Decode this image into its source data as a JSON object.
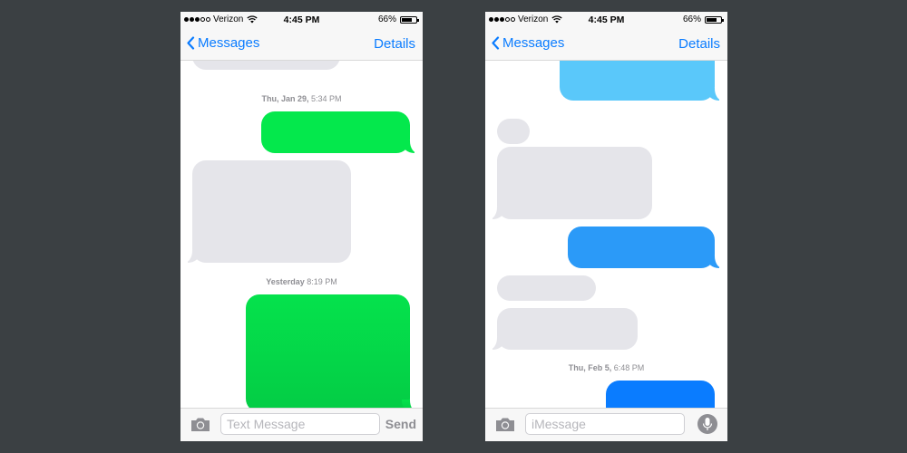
{
  "colors": {
    "background": "#3b4043",
    "ios_blue": "#0a7cff",
    "sms_green": "#04e84c",
    "received_gray": "#e5e5ea"
  },
  "left_phone": {
    "status": {
      "carrier": "Verizon",
      "time": "4:45 PM",
      "battery": "66%",
      "battery_level": 0.66
    },
    "nav": {
      "back_label": "Messages",
      "details_label": "Details"
    },
    "timestamps": [
      {
        "day": "Thu, Jan 29,",
        "time": "5:34 PM"
      },
      {
        "day": "Yesterday",
        "time": "8:19 PM"
      }
    ],
    "input": {
      "placeholder": "Text Message",
      "send_label": "Send"
    }
  },
  "right_phone": {
    "status": {
      "carrier": "Verizon",
      "time": "4:45 PM",
      "battery": "66%",
      "battery_level": 0.66
    },
    "nav": {
      "back_label": "Messages",
      "details_label": "Details"
    },
    "timestamps": [
      {
        "day": "Thu, Feb 5,",
        "time": "6:48 PM"
      }
    ],
    "input": {
      "placeholder": "iMessage"
    }
  }
}
